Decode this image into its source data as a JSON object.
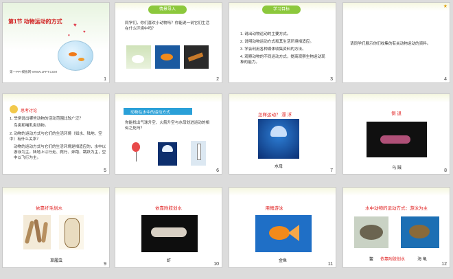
{
  "s1": {
    "title": "第1节  动物运动的方式",
    "footer": "第一PPT模板网-WWW.1PPT.COM",
    "num": "1"
  },
  "s2": {
    "badge": "情景导入",
    "text": "同学们，你们喜欢小动物吗？你能说一说它们生活在什么环境中吗？",
    "num": "2"
  },
  "s3": {
    "badge": "学习目标",
    "items": [
      "1. 说出动物运动的主要方式。",
      "2. 说明动物运动方式和其生活环境相适应。",
      "3. 学会利用各种媒体收集资料的方法。",
      "4. 观察动物的不同运动方式，提高观察生物运动现象的能力。"
    ],
    "num": "3"
  },
  "s4": {
    "text": "请同学们展示你们收集的有关动物运动的资料。",
    "num": "4"
  },
  "s5": {
    "badge": "思考讨论",
    "q1": "1. 举例说出哪些动物的活动范围比较广泛？",
    "a1": "鸟类和哺乳类动物。",
    "q2": "2. 动物的运动方式与它们的生活环境（如水、陆地、空中）有什么关系？",
    "a2": "动物的运动方式与它们的生活环境是相适应的，水中以游泳为主，陆地上以行走、爬行、奔跑、跳跃为主，空中以飞行为主。",
    "num": "5"
  },
  "s6": {
    "header": "动物在水中的运动方式",
    "text": "你能找出气球升空、火箭升空与水母划进运动的相似之处吗？",
    "num": "6"
  },
  "s7": {
    "title": "怎样运动？  漂  浮",
    "caption": "水母",
    "num": "7"
  },
  "s8": {
    "title": "倒  退",
    "caption": "乌  贼",
    "num": "8"
  },
  "s9": {
    "title": "依靠纤毛划水",
    "caption": "草履虫",
    "num": "9"
  },
  "s10": {
    "title": "依靠附肢划水",
    "caption": "虾",
    "num": "10"
  },
  "s11": {
    "title": "用鳍游泳",
    "caption": "金鱼",
    "num": "11"
  },
  "s12": {
    "title": "水中动物的运动方式：游泳为主",
    "sub": "依靠附肢划水",
    "cap1": "鳖",
    "cap2": "海  龟",
    "num": "12"
  }
}
